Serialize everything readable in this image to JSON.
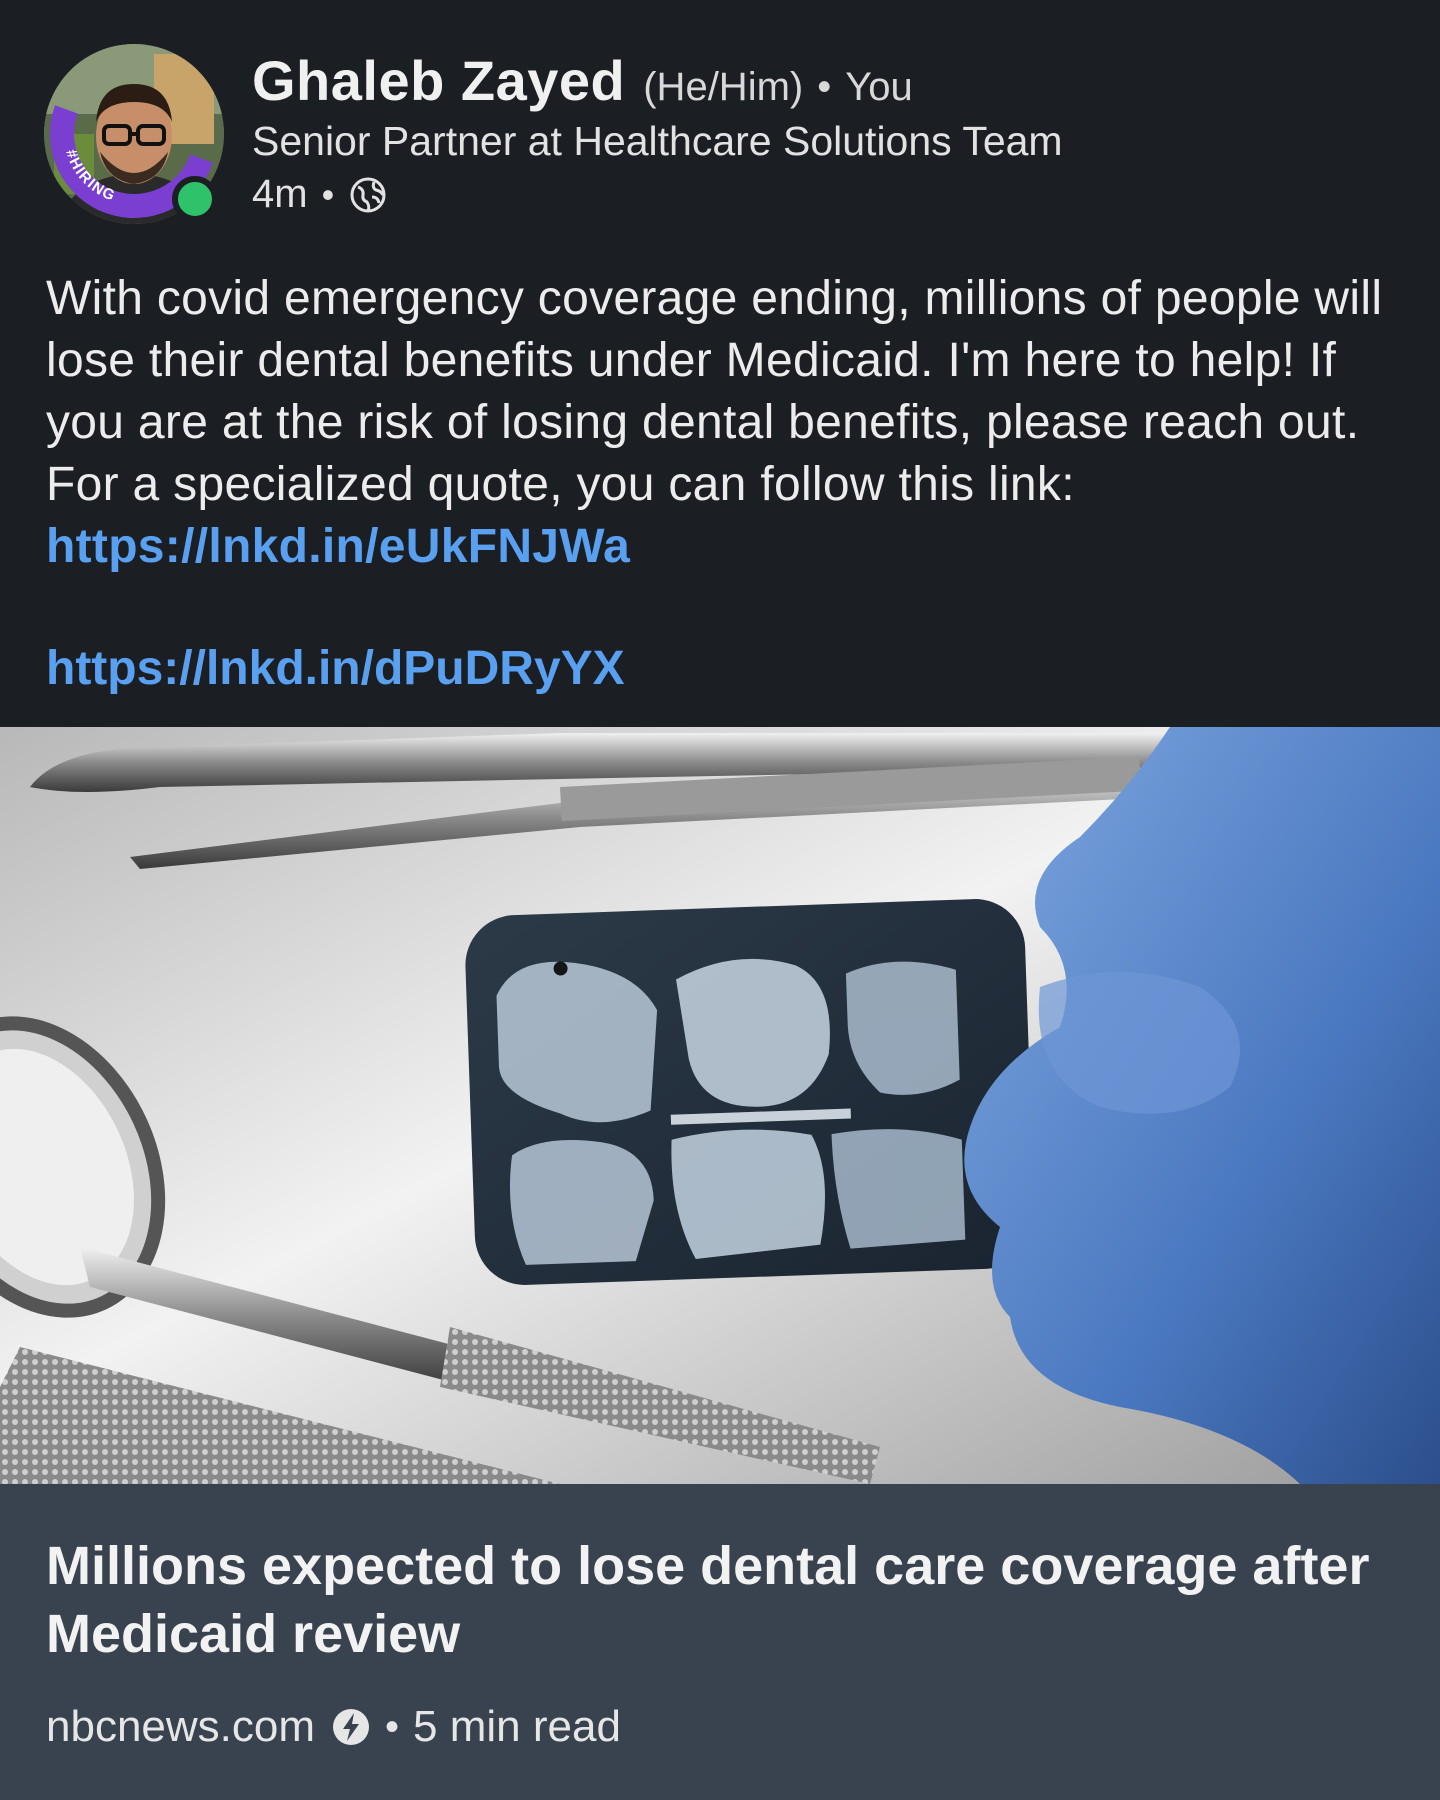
{
  "author": {
    "name": "Ghaleb Zayed",
    "pronouns": "(He/Him)",
    "relation": "You",
    "headline": "Senior Partner at Healthcare Solutions Team",
    "posted_ago": "4m",
    "badge_text": "#HIRING",
    "online": true
  },
  "post": {
    "text": "With covid emergency coverage ending, millions of people will lose their dental benefits under Medicaid. I'm here to help! If you are at the risk of losing dental benefits, please reach out. For a specialized quote, you can follow this link: ",
    "inline_link": "https://lnkd.in/eUkFNJWa",
    "second_link": "https://lnkd.in/dPuDRyYX"
  },
  "article": {
    "title": "Millions expected to lose dental care coverage after Medicaid review",
    "source": "nbcnews.com",
    "read_time": "5 min read"
  },
  "separator": "•",
  "colors": {
    "background": "#1b1f23",
    "link": "#5aa0f0",
    "card": "#38434f",
    "online": "#2ec36b",
    "badge": "#7a3fd0"
  },
  "icons": {
    "visibility": "globe-icon",
    "source_badge": "amp-lightning-icon"
  }
}
